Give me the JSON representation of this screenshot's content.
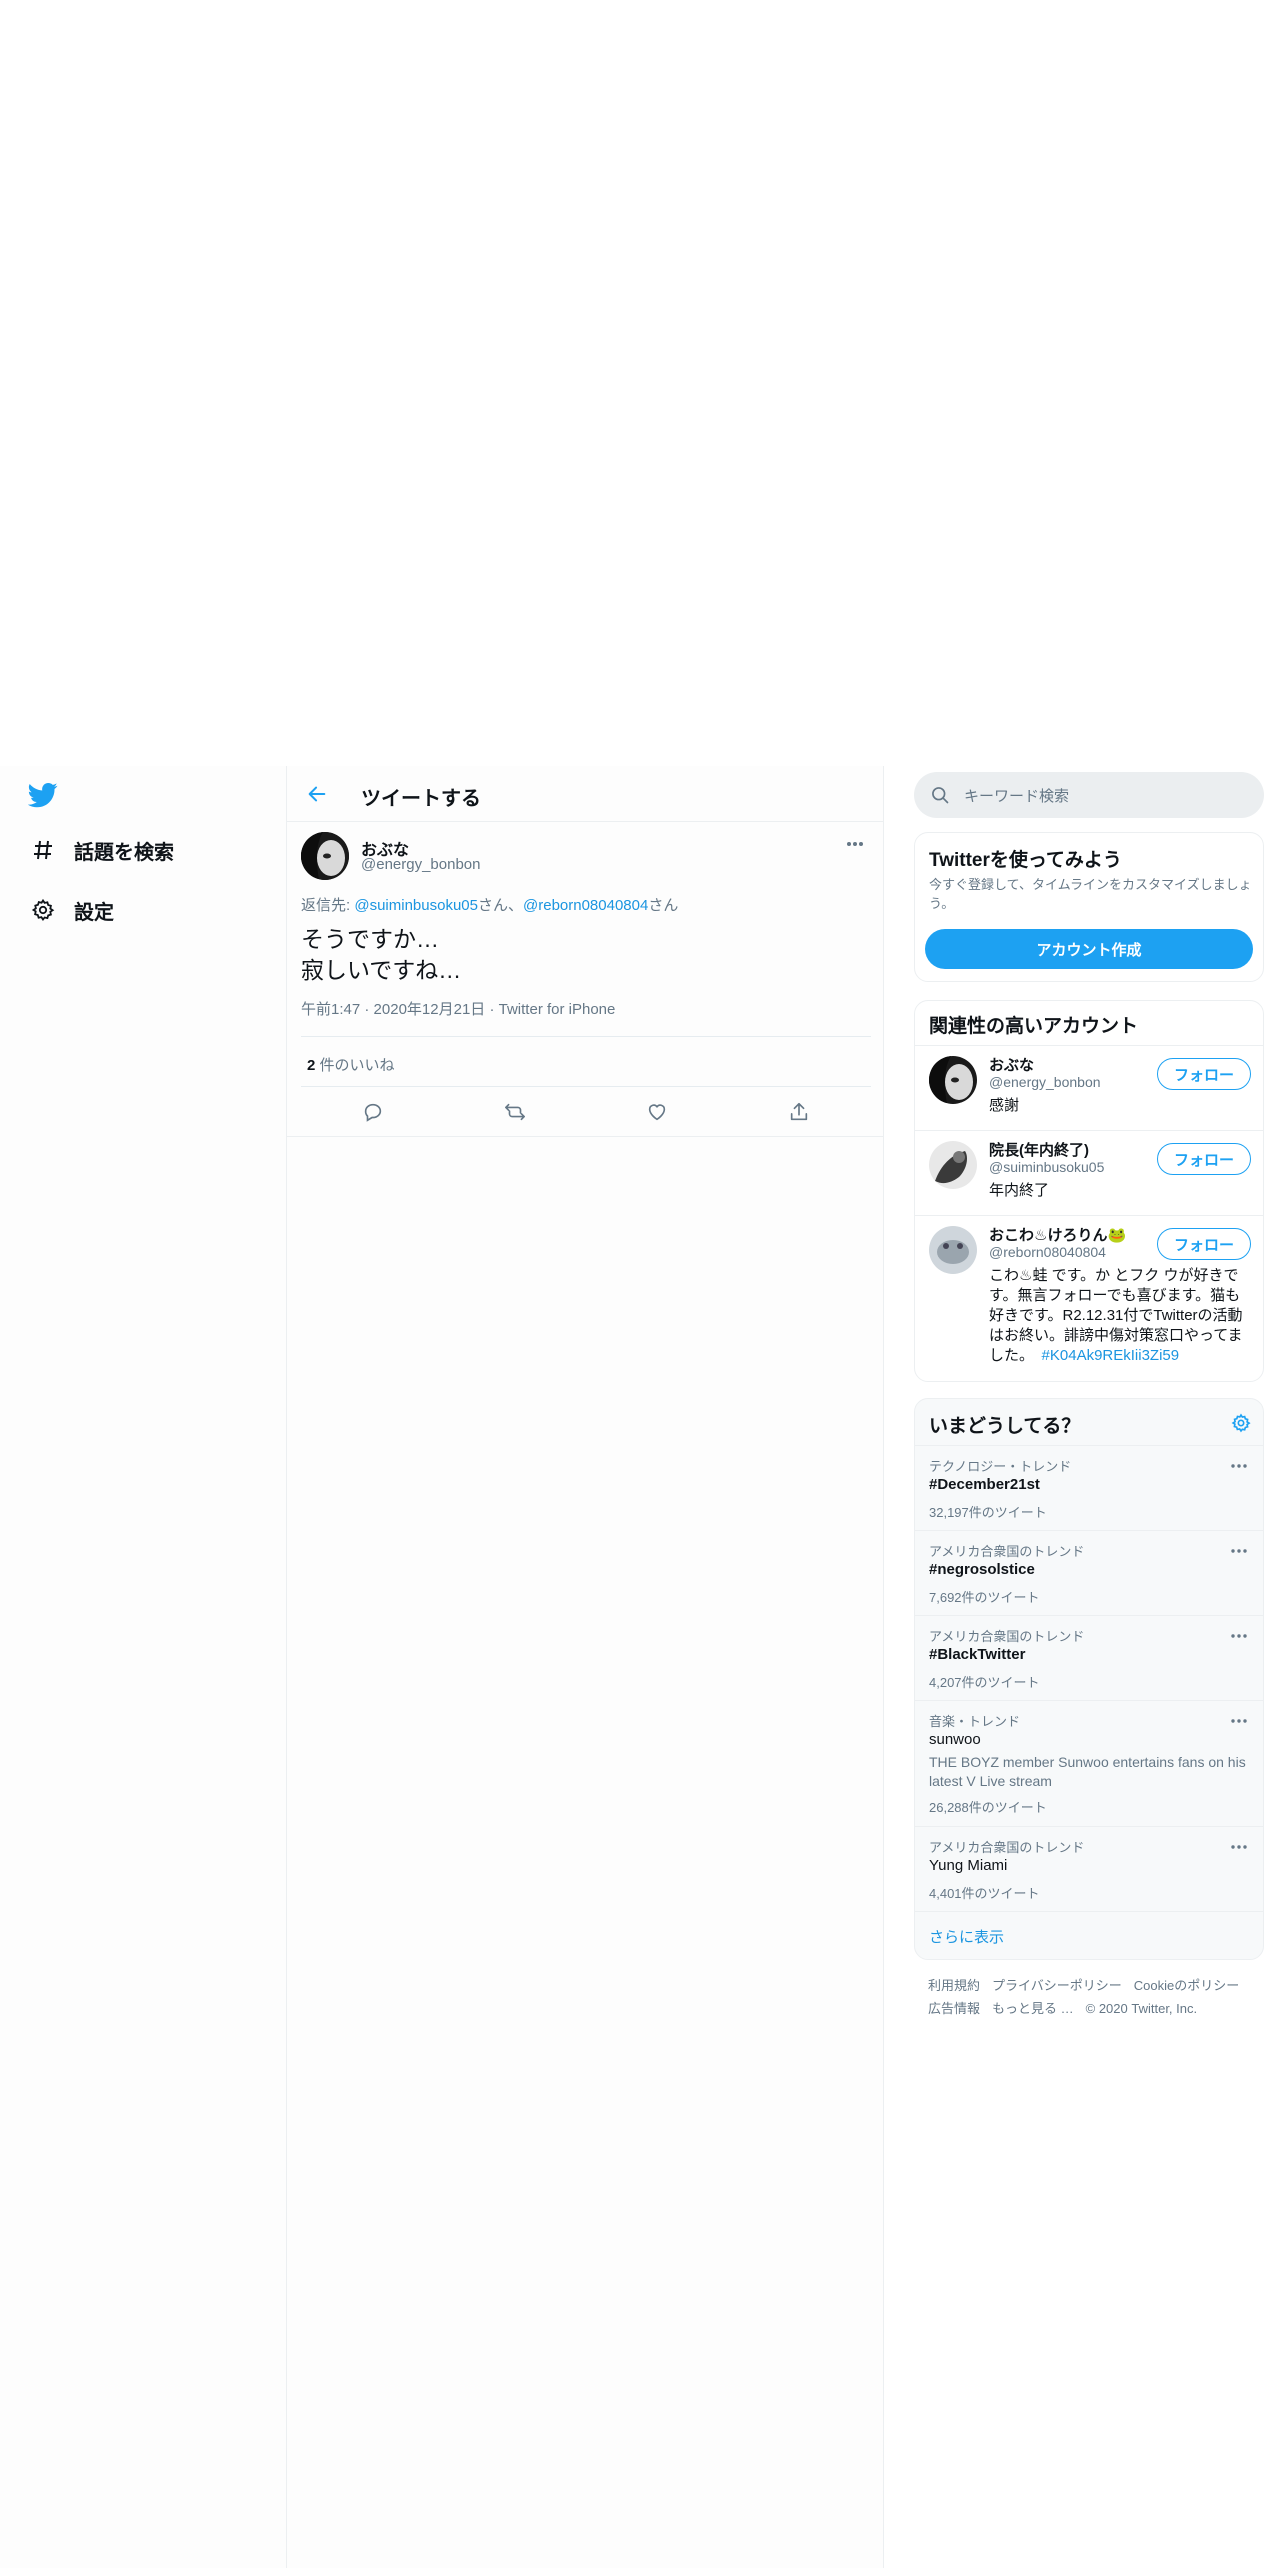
{
  "nav": {
    "explore_label": "話題を検索",
    "settings_label": "設定"
  },
  "header": {
    "title": "ツイートする"
  },
  "tweet": {
    "name": "おぶな",
    "handle": "@energy_bonbon",
    "reply_prefix": "返信先: ",
    "reply_user1": "@suiminbusoku05",
    "reply_sep1": "さん、",
    "reply_user2": "@reborn08040804",
    "reply_sep2": "さん",
    "text_line1": "そうですか…",
    "text_line2": "寂しいですね…",
    "time": "午前1:47",
    "date": "2020年12月21日",
    "source": "Twitter for iPhone",
    "likes_count": "2",
    "likes_label": " 件のいいね"
  },
  "search": {
    "placeholder": "キーワード検索"
  },
  "signup": {
    "title": "Twitterを使ってみよう",
    "desc": "今すぐ登録して、タイムラインをカスタマイズしましょう。",
    "button": "アカウント作成"
  },
  "relevant": {
    "title": "関連性の高いアカウント",
    "follow_label": "フォロー",
    "accounts": [
      {
        "name": "おぶな",
        "handle": "@energy_bonbon",
        "bio": "感謝"
      },
      {
        "name": "院長(年内終了)",
        "handle": "@suiminbusoku05",
        "bio": "年内終了"
      },
      {
        "name": "おこわ♨けろりん🐸",
        "handle": "@reborn08040804",
        "bio": "こわ♨蛙 です。か とフク ウが好きです。無言フォローでも喜びます。猫も好きです。R2.12.31付でTwitterの活動はお終い。誹謗中傷対策窓口やってました。",
        "bio_tag": "#K04Ak9REkIii3Zi59"
      }
    ]
  },
  "trends": {
    "title": "いまどうしてる？",
    "items": [
      {
        "category": "テクノロジー・トレンド",
        "name": "#December21st",
        "count": "32,197件のツイート"
      },
      {
        "category": "アメリカ合衆国のトレンド",
        "name": "#negrosolstice",
        "count": "7,692件のツイート"
      },
      {
        "category": "アメリカ合衆国のトレンド",
        "name": "#BlackTwitter",
        "count": "4,207件のツイート"
      },
      {
        "category": "音楽・トレンド",
        "name": "sunwoo",
        "desc": "THE BOYZ member Sunwoo entertains fans on his latest V Live stream",
        "count": "26,288件のツイート"
      },
      {
        "category": "アメリカ合衆国のトレンド",
        "name": "Yung Miami",
        "count": "4,401件のツイート"
      }
    ],
    "show_more": "さらに表示"
  },
  "footer": {
    "terms": "利用規約",
    "privacy": "プライバシーポリシー",
    "cookie": "Cookieのポリシー",
    "ads": "広告情報",
    "more": "もっと見る …",
    "copyright": "© 2020 Twitter, Inc."
  },
  "colors": {
    "accent": "#1da1f2",
    "link": "#1b95e0",
    "secondary_text": "#657786"
  }
}
